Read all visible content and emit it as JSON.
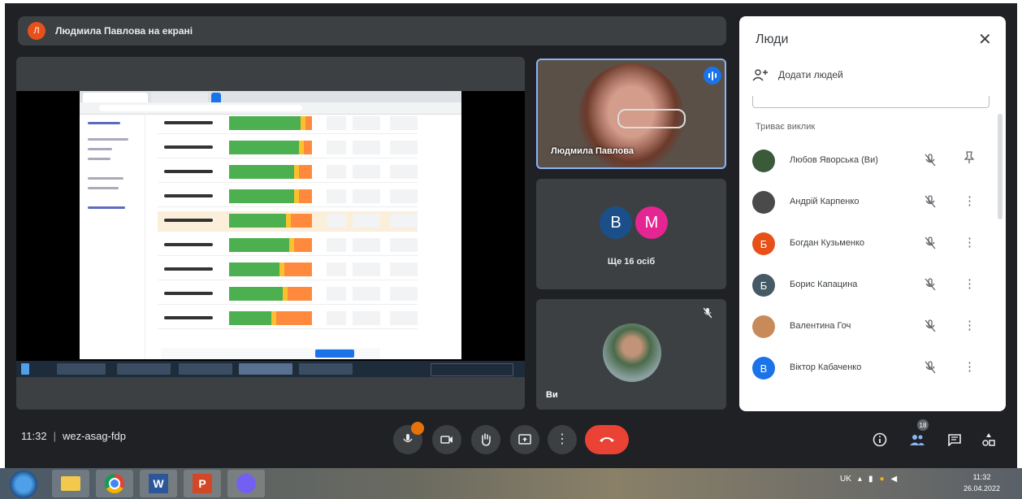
{
  "presenter": {
    "initial": "Л",
    "text": "Людмила Павлова на екрані"
  },
  "tiles": {
    "speaker_name": "Людмила Павлова",
    "group": {
      "avatars": [
        {
          "letter": "B",
          "color": "#1a4f8a"
        },
        {
          "letter": "M",
          "color": "#e52592"
        }
      ],
      "label": "Ще 16 осіб"
    },
    "self_label": "Ви"
  },
  "people_panel": {
    "title": "Люди",
    "add_people": "Додати людей",
    "section_title": "Триває виклик",
    "participants": [
      {
        "name": "Любов Яворська (Ви)",
        "avatar": "photo",
        "color": "#3a5a3a",
        "initial": ""
      },
      {
        "name": "Андрій Карпенко",
        "avatar": "photo",
        "color": "#4a4a4a",
        "initial": ""
      },
      {
        "name": "Богдан Кузьменко",
        "avatar": "letter",
        "color": "#e8501a",
        "initial": "Б"
      },
      {
        "name": "Борис Капацина",
        "avatar": "letter",
        "color": "#455a64",
        "initial": "Б"
      },
      {
        "name": "Валентина Гоч",
        "avatar": "photo",
        "color": "#c98a5a",
        "initial": ""
      },
      {
        "name": "Віктор Кабаченко",
        "avatar": "letter",
        "color": "#1a73e8",
        "initial": "В"
      }
    ]
  },
  "controls": {
    "time": "11:32",
    "meeting_code": "wez-asag-fdp",
    "people_count": "18",
    "colors": {
      "end_call": "#ea4335",
      "accent": "#1a73e8"
    }
  },
  "taskbar": {
    "apps": [
      "explorer-icon",
      "chrome-icon",
      "word-icon",
      "powerpoint-icon",
      "viber-icon"
    ],
    "lang": "UK",
    "clock_time": "11:32",
    "clock_date": "26.04.2022"
  }
}
